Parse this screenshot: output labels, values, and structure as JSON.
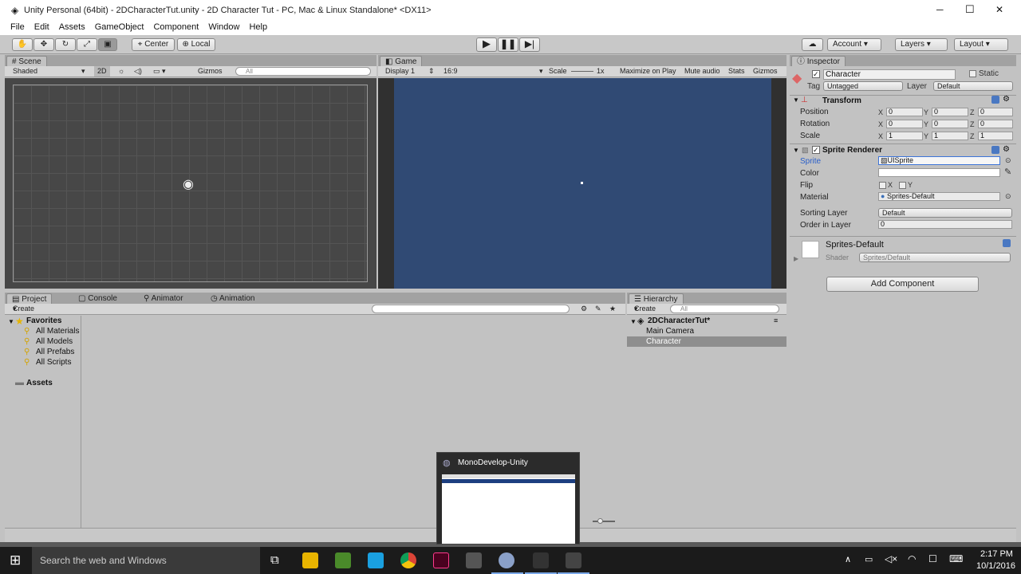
{
  "window": {
    "title": "Unity Personal (64bit) - 2DCharacterTut.unity - 2D Character Tut - PC, Mac & Linux Standalone* <DX11>",
    "minimize": "─",
    "maximize": "☐",
    "close": "✕"
  },
  "menu": [
    "File",
    "Edit",
    "Assets",
    "GameObject",
    "Component",
    "Window",
    "Help"
  ],
  "toolbar": {
    "center": "Center",
    "local": "Local",
    "account": "Account",
    "layers": "Layers",
    "layout": "Layout"
  },
  "scene": {
    "tab": "Scene",
    "shading": "Shaded",
    "mode2d": "2D",
    "gizmos": "Gizmos",
    "search_placeholder": "All"
  },
  "game": {
    "tab": "Game",
    "display": "Display 1",
    "aspect": "16:9",
    "scale_label": "Scale",
    "scale_value": "1x",
    "maximize": "Maximize on Play",
    "mute": "Mute audio",
    "stats": "Stats",
    "gizmos": "Gizmos"
  },
  "inspector": {
    "tab": "Inspector",
    "name": "Character",
    "static": "Static",
    "tag_label": "Tag",
    "tag": "Untagged",
    "layer_label": "Layer",
    "layer": "Default",
    "transform": {
      "title": "Transform",
      "rows": [
        {
          "label": "Position",
          "x": "0",
          "y": "0",
          "z": "0"
        },
        {
          "label": "Rotation",
          "x": "0",
          "y": "0",
          "z": "0"
        },
        {
          "label": "Scale",
          "x": "1",
          "y": "1",
          "z": "1"
        }
      ]
    },
    "sprite_renderer": {
      "title": "Sprite Renderer",
      "sprite_label": "Sprite",
      "sprite": "UISprite",
      "color_label": "Color",
      "flip_label": "Flip",
      "flip_x": "X",
      "flip_y": "Y",
      "material_label": "Material",
      "material": "Sprites-Default",
      "sorting_label": "Sorting Layer",
      "sorting": "Default",
      "order_label": "Order in Layer",
      "order": "0"
    },
    "material": {
      "name": "Sprites-Default",
      "shader_label": "Shader",
      "shader": "Sprites/Default"
    },
    "add_component": "Add Component",
    "axis": {
      "x": "X",
      "y": "Y",
      "z": "Z"
    }
  },
  "project": {
    "tabs": [
      "Project",
      "Console",
      "Animator",
      "Animation"
    ],
    "create": "Create",
    "favorites": "Favorites",
    "favorite_items": [
      "All Materials",
      "All Models",
      "All Prefabs",
      "All Scripts"
    ],
    "assets": "Assets"
  },
  "hierarchy": {
    "tab": "Hierarchy",
    "create": "Create",
    "search_placeholder": "All",
    "scene_name": "2DCharacterTut*",
    "items": [
      "Main Camera",
      "Character"
    ]
  },
  "popup": {
    "title": "MonoDevelop-Unity"
  },
  "taskbar": {
    "search": "Search the web and Windows",
    "time": "2:17 PM",
    "date": "10/1/2016"
  },
  "colors": {
    "game_bg": "#304a74",
    "scene_bg": "#474747",
    "selected": "#8e8e8e"
  }
}
